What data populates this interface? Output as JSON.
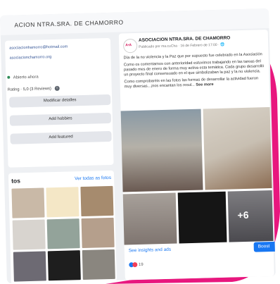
{
  "page_header": {
    "title": "ACION NTRA.SRA. DE CHAMORRO"
  },
  "about": {
    "email": "asociacionhamorro@hotmail.com",
    "website": "asociacionchamorro.org",
    "status": "Abierto ahora",
    "rating": "Rating · 5,0 (3 Reviews)",
    "edit_button": "Modificar detalles",
    "hobbies_button": "Add hobbies",
    "featured_button": "Add featured"
  },
  "photos": {
    "title": "tos",
    "see_all": "Ver todas as fotos"
  },
  "post": {
    "author": "ASOCIACION NTRA.SRA. DE CHAMORRO",
    "meta": "Publicado por ma.cuCha · 16 de Febrero de 17:00 · ",
    "paragraph1": "Día de la no violencia y la Paz que por supuesto fue celebrado en la Asociación",
    "paragraph2": "Como os comentamos con anterioridad estuvimos trabajando en las tareas del pasado mes de enero de forma muy activa esta temática. Cada grupo desarrolló un proyecto final consensuado en el que simbolizaban la paz y la no violencia.",
    "paragraph3": "Como comprobaréis en las fotos las formas de desarrollar la actividad fueron muy diversas...¡nos encantan los resul...",
    "see_more": "See more",
    "more_photos": "+6",
    "insights_link": "See insights and ads",
    "boost_button": "Boost",
    "reactions_count": "19"
  },
  "colors": {
    "brand": "#d4145a",
    "link": "#1877f2"
  }
}
